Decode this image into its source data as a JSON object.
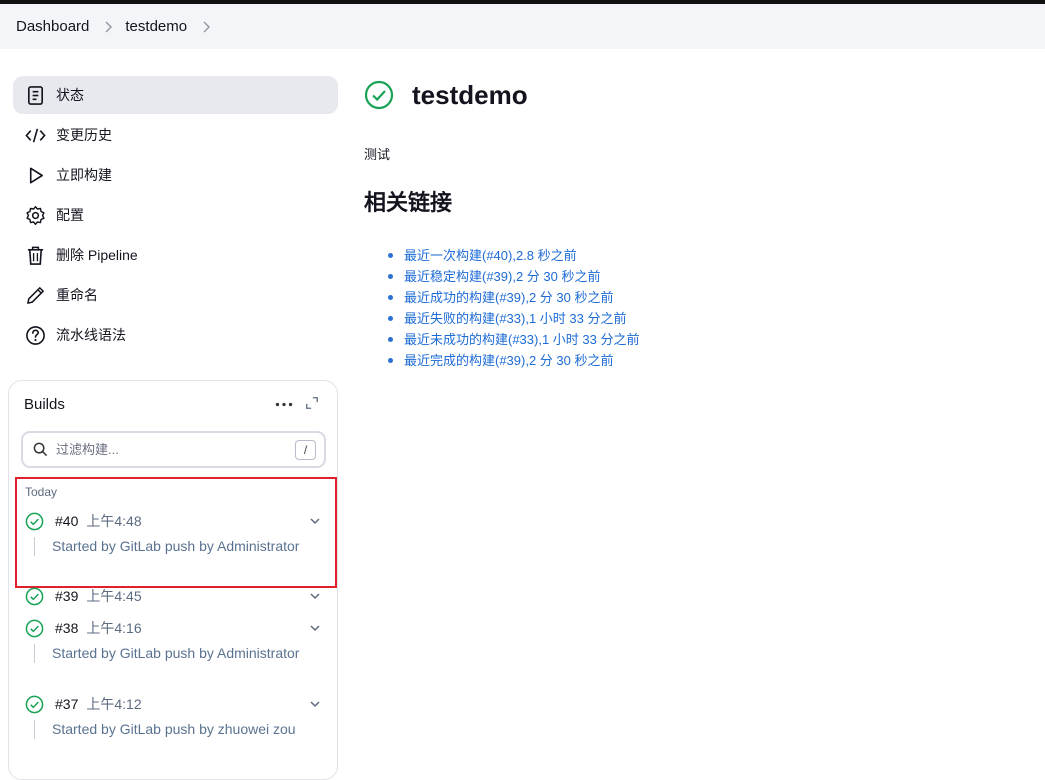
{
  "breadcrumb": {
    "items": [
      "Dashboard",
      "testdemo"
    ]
  },
  "sidebar": {
    "tasks": [
      {
        "label": "状态",
        "icon": "document-icon"
      },
      {
        "label": "变更历史",
        "icon": "code-icon"
      },
      {
        "label": "立即构建",
        "icon": "play-icon"
      },
      {
        "label": "配置",
        "icon": "gear-icon"
      },
      {
        "label": "删除 Pipeline",
        "icon": "trash-icon"
      },
      {
        "label": "重命名",
        "icon": "pencil-icon"
      },
      {
        "label": "流水线语法",
        "icon": "help-icon"
      }
    ]
  },
  "builds": {
    "title": "Builds",
    "filter_placeholder": "过滤构建...",
    "filter_shortcut": "/",
    "group_label": "Today",
    "items": [
      {
        "number": "#40",
        "time": "上午4:48",
        "description": "Started by GitLab push by Administrator"
      },
      {
        "number": "#39",
        "time": "上午4:45",
        "description": ""
      },
      {
        "number": "#38",
        "time": "上午4:16",
        "description": "Started by GitLab push by Administrator"
      },
      {
        "number": "#37",
        "time": "上午4:12",
        "description": "Started by GitLab push by zhuowei zou"
      }
    ]
  },
  "main": {
    "title": "testdemo",
    "description": "测试",
    "links_title": "相关链接",
    "links": [
      "最近一次构建(#40),2.8 秒之前",
      "最近稳定构建(#39),2 分 30 秒之前",
      "最近成功的构建(#39),2 分 30 秒之前",
      "最近失败的构建(#33),1 小时 33 分之前",
      "最近未成功的构建(#33),1 小时 33 分之前",
      "最近完成的构建(#39),2 分 30 秒之前"
    ]
  },
  "colors": {
    "success": "#1aa356",
    "link": "#1d6bd6",
    "highlight": "#e0202a"
  }
}
